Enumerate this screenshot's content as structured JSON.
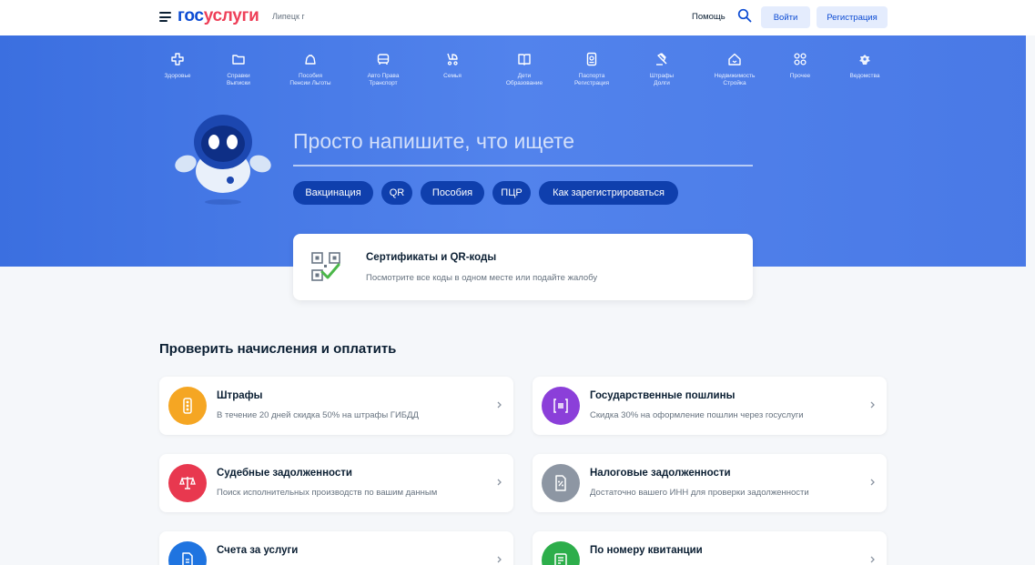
{
  "header": {
    "logo_part1": "гос",
    "logo_part2": "услуги",
    "city": "Липецк г",
    "help": "Помощь",
    "login": "Войти",
    "register": "Регистрация"
  },
  "categories": [
    {
      "label": "Здоровье",
      "icon": "health-icon"
    },
    {
      "label": "Справки\nВыписки",
      "icon": "folder-icon"
    },
    {
      "label": "Пособия\nПенсии Льготы",
      "icon": "purse-icon"
    },
    {
      "label": "Авто Права\nТранспорт",
      "icon": "car-icon"
    },
    {
      "label": "Семья",
      "icon": "stroller-icon"
    },
    {
      "label": "Дети\nОбразование",
      "icon": "book-icon"
    },
    {
      "label": "Паспорта\nРегистрация",
      "icon": "passport-icon"
    },
    {
      "label": "Штрафы\nДолги",
      "icon": "gavel-icon"
    },
    {
      "label": "Недвижимость\nСтройка",
      "icon": "house-icon"
    },
    {
      "label": "Прочее",
      "icon": "grid-icon"
    },
    {
      "label": "Ведомства",
      "icon": "emblem-icon"
    }
  ],
  "hero": {
    "search_prompt": "Просто напишите, что ищете",
    "chips": [
      "Вакцинация",
      "QR",
      "Пособия",
      "ПЦР",
      "Как зарегистрироваться"
    ]
  },
  "qr_card": {
    "title": "Сертификаты и QR-коды",
    "subtitle": "Посмотрите все коды в одном месте или подайте жалобу"
  },
  "payments": {
    "title": "Проверить начисления и оплатить",
    "cards": [
      {
        "title": "Штрафы",
        "subtitle": "В течение 20 дней скидка 50% на штрафы ГИБДД",
        "icon": "traffic-light-icon",
        "color": "#f5a623"
      },
      {
        "title": "Государственные пошлины",
        "subtitle": "Скидка 30% на оформление пошлин через госуслуги",
        "icon": "duty-icon",
        "color": "#8b3fd9"
      },
      {
        "title": "Судебные задолженности",
        "subtitle": "Поиск исполнительных производств по вашим данным",
        "icon": "scales-icon",
        "color": "#e8384f"
      },
      {
        "title": "Налоговые задолженности",
        "subtitle": "Достаточно вашего ИНН для проверки задолженности",
        "icon": "tax-document-icon",
        "color": "#8d96a3"
      },
      {
        "title": "Счета за услуги",
        "subtitle": "",
        "icon": "invoice-icon",
        "color": "#1f74e0"
      },
      {
        "title": "По номеру квитанции",
        "subtitle": "",
        "icon": "receipt-icon",
        "color": "#2dae4b"
      }
    ]
  }
}
